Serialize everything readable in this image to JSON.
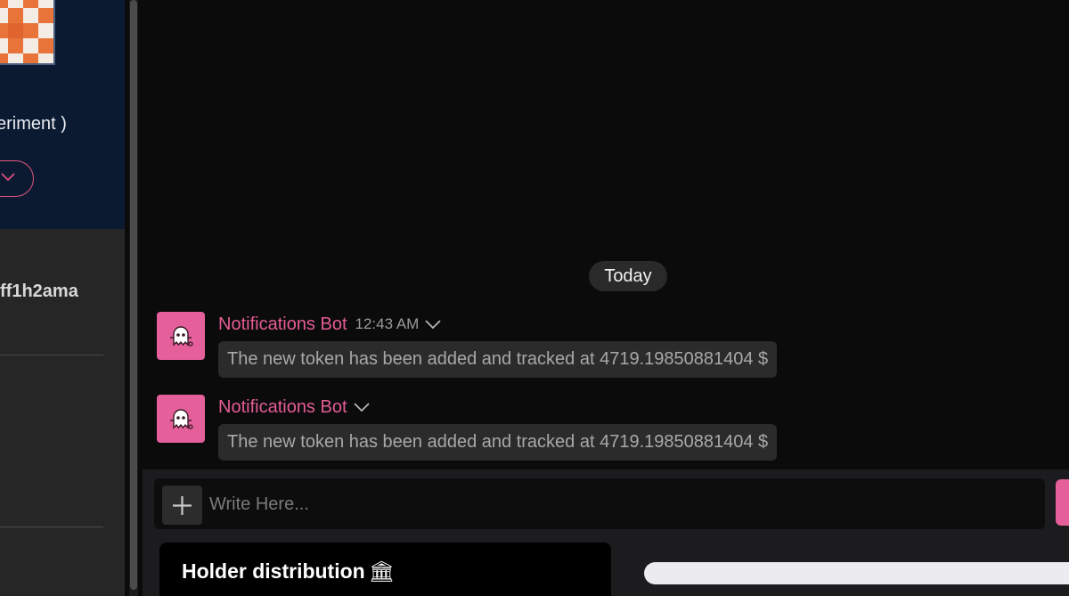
{
  "sidebar": {
    "profile_name": "eriment )",
    "wallet_label": "ff1h2ama"
  },
  "chat": {
    "date_separator": "Today",
    "messages": [
      {
        "author": "Notifications Bot",
        "time": "12:43 AM",
        "text": "The new token has been added and tracked at 4719.19850881404 $"
      },
      {
        "author": "Notifications Bot",
        "time": "",
        "text": "The new token has been added and tracked at 4719.19850881404 $"
      }
    ]
  },
  "composer": {
    "placeholder": "Write Here..."
  },
  "holders": {
    "title": "Holder distribution",
    "emoji": "🏛"
  },
  "colors": {
    "accent_pink": "#e5609a",
    "bot_name": "#e55c93",
    "profile_bg": "#0c1a31"
  },
  "icons": {
    "add": "plus-icon",
    "bot": "ghost-bot-icon",
    "dropdown": "chevron-down-icon"
  }
}
